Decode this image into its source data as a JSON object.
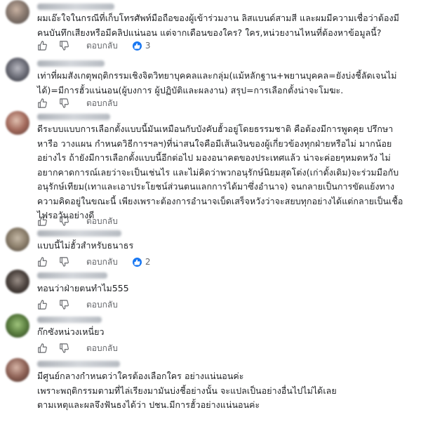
{
  "ui": {
    "reply_label": "ตอบกลับ",
    "like_icon": "thumbs-up-icon",
    "dislike_icon": "thumbs-down-icon",
    "reaction_color": "#1877f2"
  },
  "comments": [
    {
      "lines": [
        "ผมเอ๊ะใจในกรณีที่เก็บโทรศัพท์มือถือของผู้เข้าร่วมงาน ลิสแบนด์สามสี และผมมีความเชื่อว่าต้องมี",
        "คนบันทึกเสียงหรือมีคลิปแน่นอน แต่จากเดือนของใคร? ใคร,หน่วยงานไหนที่ต้องหาข้อมูลนี้?"
      ],
      "reactions": "3"
    },
    {
      "lines": [
        "เท่าที่ผมสังเกตุพฤติกรรมเชิงจิตวิทยาบุคคลและกลุ่ม(แม้หลักฐาน+พยานบุคคล=ยังบ่งชี้ลัดเจนไม่",
        "ได้)=มีการฮั้วแน่นอน(ผู้บงการ ผู้ปฏิบัติและผลงาน) สรุป=การเลือกตั้งน่าจะโมฆะ."
      ]
    },
    {
      "lines": [
        "ดีระบบแบบการเลือกตั้งแบบนี้มันเหมือนกับบังคับฮั้วอยู่โดยธรรมชาติ คือต้องมีการพูดคุย ปรึกษา",
        "หารือ วางแผน กำหนดวิธีการฯลฯ)ที่น่าสนใจคือมีเส้นเงินของผู้เกี่ยวข้องทุกฝ่ายหรือไม่ มากน้อย",
        "อย่างไร ถ้ายังมีการเลือกตั้งแบบนี้อีกต่อไป มองอนาคตของประเทศแล้ว น่าจะค่อยๆหมดหวัง ไม่",
        "อยากคาดการณ์เลยว่าจะเป็นเช่นไร และไม่คิดว่าพวกอนุรักษ์นิยมสุดโต่ง(เก่าดั้งเดิม)จะร่วมมือกับ",
        "อนุรักษ์เทียม(เทาและเอาประโยชน์ส่วนตนแลกการได้มาซึ่งอำนาจ) จนกลายเป็นการขัดแย้งทาง",
        "ความคิดอยู่ในขณะนี้ เพียงเพราะต้องการอำนาจเบ็ดเสร็จหวังว่าจะสยบทุกอย่างได้แต่กลายเป็นเชื้อ",
        "ไฟรอวันอย่างดี"
      ]
    },
    {
      "lines": [
        "แบบนี้ไม่ฮั้วสำหรับธนาธร"
      ],
      "reactions": "2"
    },
    {
      "lines": [
        "ทอนว่าฝ่ายตนทำไม555"
      ]
    },
    {
      "lines": [
        "ก๊กซังหน่วงเหนี่ยว"
      ]
    },
    {
      "lines": [
        "มีศูนย์กลางกำหนดว่าใครต้องเลือกใคร อย่างแน่นอนค่ะ",
        "เพราะพฤติกรรมตามที่ไล่เรียงมามันบ่งชี้อย่างนั้น จะแปลเป็นอย่างอื่นไปไม่ได้เลย",
        "ตามเหตุและผลจึงฟันธงได้ว่า ปชน.มีการฮั้วอย่างแน่นอนค่ะ"
      ]
    }
  ]
}
